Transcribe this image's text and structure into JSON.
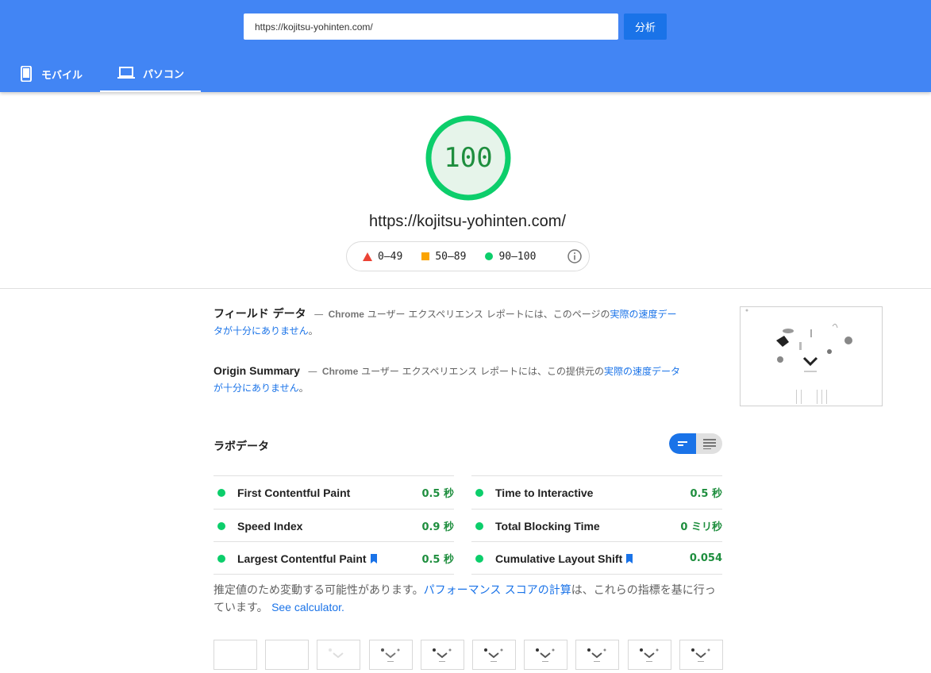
{
  "header": {
    "url_value": "https://kojitsu-yohinten.com/",
    "analyze_label": "分析",
    "tabs": [
      {
        "label": "モバイル",
        "icon": "phone-icon",
        "active": false
      },
      {
        "label": "パソコン",
        "icon": "laptop-icon",
        "active": true
      }
    ]
  },
  "summary": {
    "score": "100",
    "url": "https://kojitsu-yohinten.com/",
    "legend": [
      {
        "range": "0–49",
        "color": "#eb4335",
        "shape": "triangle"
      },
      {
        "range": "50–89",
        "color": "#fba400",
        "shape": "square"
      },
      {
        "range": "90–100",
        "color": "#0cce6b",
        "shape": "circle"
      }
    ]
  },
  "field_data": {
    "title": "フィールド データ",
    "dash": "—",
    "chrome": "Chrome",
    "text": " ユーザー エクスペリエンス レポートには、このページの",
    "link": "実際の速度データが十分にありません",
    "end": "。"
  },
  "origin_summary": {
    "title": "Origin Summary",
    "dash": "—",
    "chrome": "Chrome",
    "text": " ユーザー エクスペリエンス レポートには、この提供元の",
    "link": "実際の速度データが十分にありません",
    "end": "。"
  },
  "lab_data": {
    "title": "ラボデータ",
    "metrics_left": [
      {
        "name": "First Contentful Paint",
        "value": "0.5 秒",
        "bookmark": false
      },
      {
        "name": "Speed Index",
        "value": "0.9 秒",
        "bookmark": false
      },
      {
        "name": "Largest Contentful Paint",
        "value": "0.5 秒",
        "bookmark": true
      }
    ],
    "metrics_right": [
      {
        "name": "Time to Interactive",
        "value": "0.5 秒",
        "bookmark": false
      },
      {
        "name": "Total Blocking Time",
        "value": "0 ミリ秒",
        "bookmark": false
      },
      {
        "name": "Cumulative Layout Shift",
        "value": "0.054",
        "bookmark": true
      }
    ],
    "note_text": "推定値のため変動する可能性があります。",
    "note_link": "パフォーマンス スコアの計算",
    "note_text2": "は、これらの指標を基に行っています。",
    "note_calc": "See calculator."
  },
  "colors": {
    "header_bg": "#4285f4",
    "pass_green": "#0cce6b",
    "score_text": "#1e8e3e",
    "link_blue": "#1a73e8"
  }
}
